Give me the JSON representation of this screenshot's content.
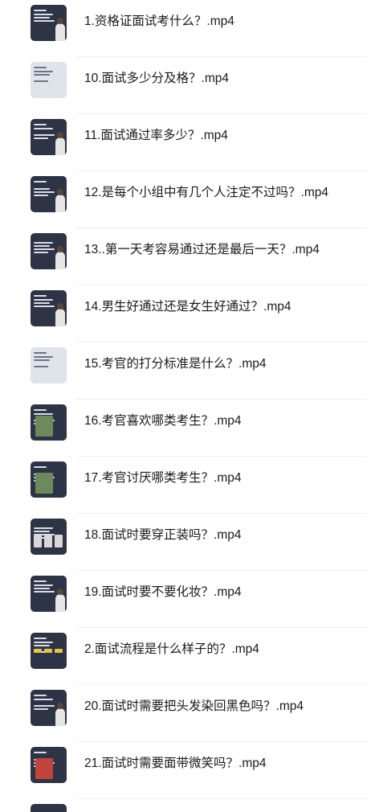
{
  "files": [
    {
      "name": "1.资格证面试考什么？.mp4",
      "thumb": "video-thumbnail"
    },
    {
      "name": "10.面试多少分及格？.mp4",
      "thumb": "video-thumbnail"
    },
    {
      "name": "11.面试通过率多少？.mp4",
      "thumb": "video-thumbnail"
    },
    {
      "name": "12.是每个小组中有几个人注定不过吗？.mp4",
      "thumb": "video-thumbnail"
    },
    {
      "name": "13..第一天考容易通过还是最后一天？.mp4",
      "thumb": "video-thumbnail"
    },
    {
      "name": "14.男生好通过还是女生好通过？.mp4",
      "thumb": "video-thumbnail"
    },
    {
      "name": "15.考官的打分标准是什么？.mp4",
      "thumb": "video-thumbnail"
    },
    {
      "name": "16.考官喜欢哪类考生？.mp4",
      "thumb": "video-thumbnail"
    },
    {
      "name": "17.考官讨厌哪类考生？.mp4",
      "thumb": "video-thumbnail"
    },
    {
      "name": "18.面试时要穿正装吗？.mp4",
      "thumb": "video-thumbnail"
    },
    {
      "name": "19.面试时要不要化妆？.mp4",
      "thumb": "video-thumbnail"
    },
    {
      "name": "2.面试流程是什么样子的？.mp4",
      "thumb": "video-thumbnail"
    },
    {
      "name": "20.面试时需要把头发染回黑色吗？.mp4",
      "thumb": "video-thumbnail"
    },
    {
      "name": "21.面试时需要面带微笑吗？.mp4",
      "thumb": "video-thumbnail"
    }
  ],
  "colors": {
    "thumb_bg": "#2d3446",
    "text": "#1a1a1a",
    "divider": "#efefef",
    "accent_yellow": "#e8c34a"
  }
}
